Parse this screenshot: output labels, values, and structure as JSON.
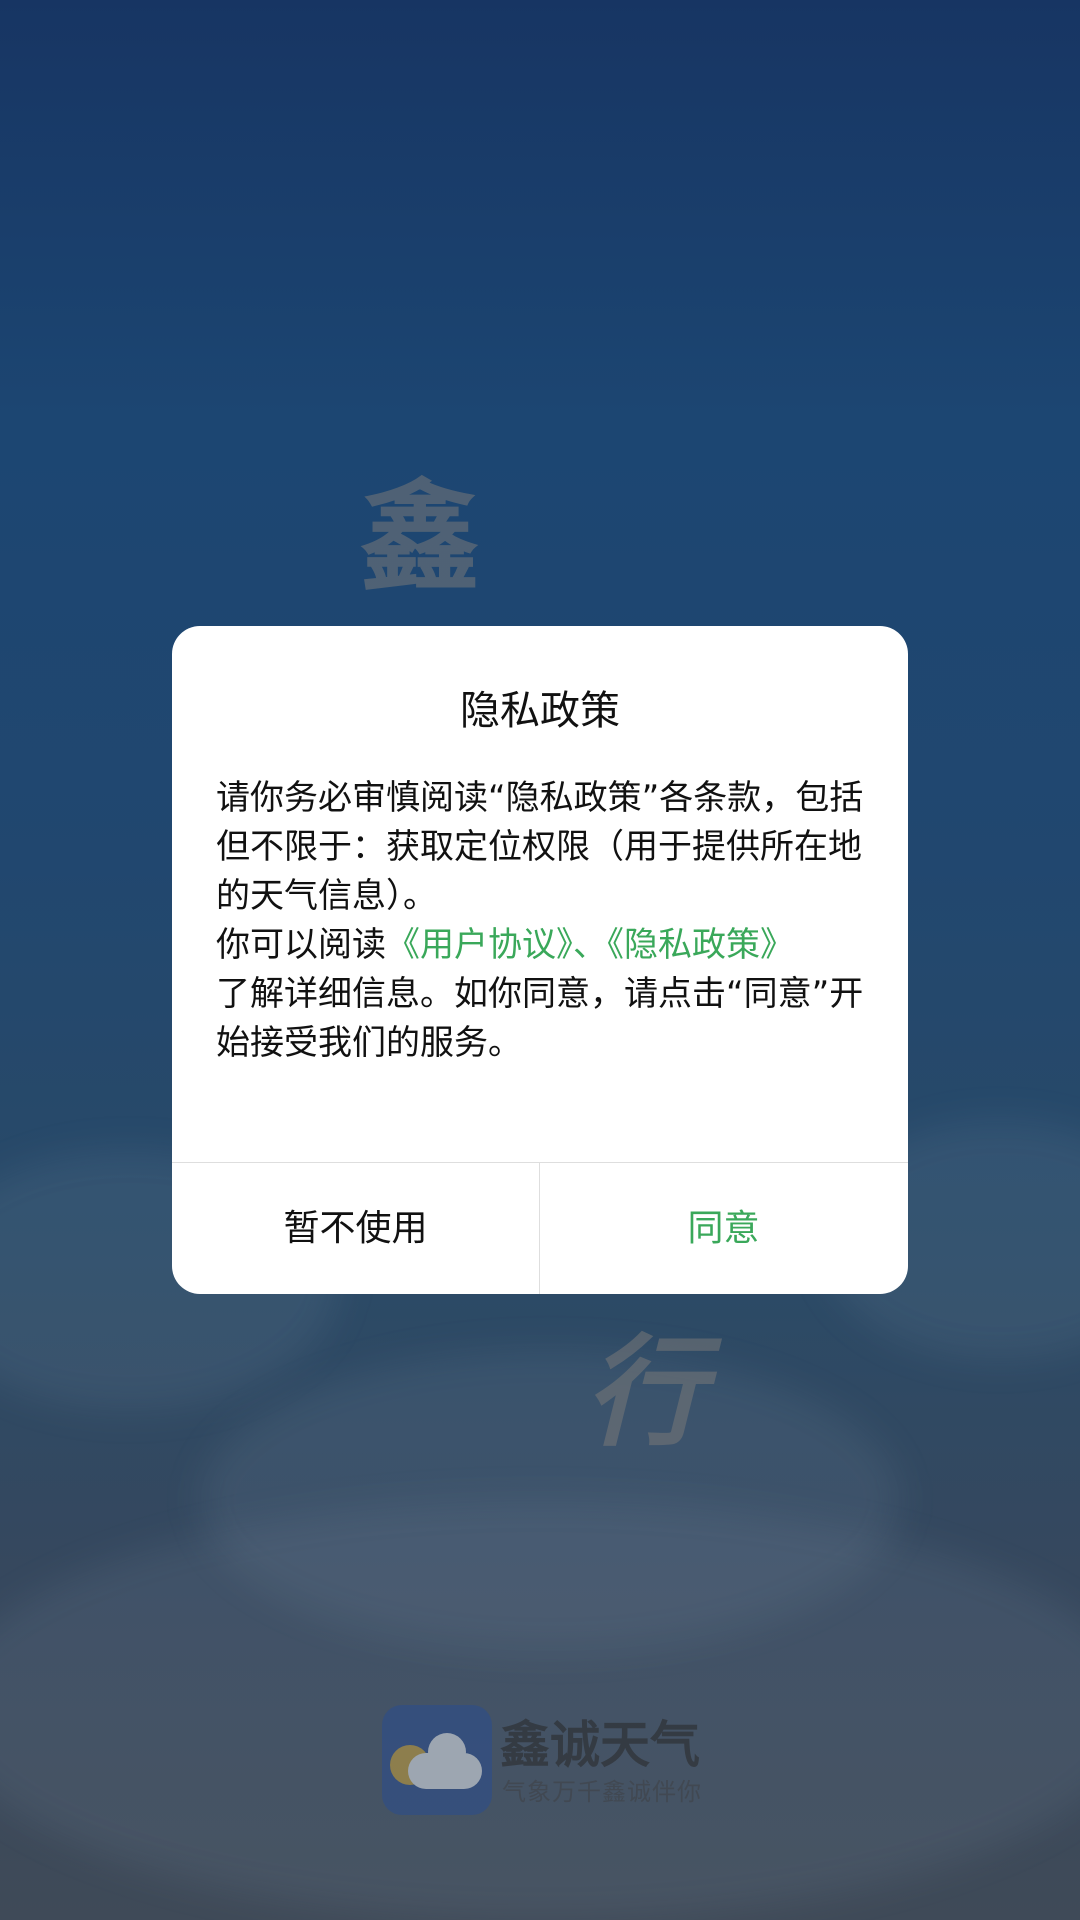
{
  "background": {
    "char_top": "鑫",
    "char_mid": "行"
  },
  "splash": {
    "app_name": "鑫诚天气",
    "slogan": "气象万千鑫诚伴你",
    "logo_icon": "weather-app-logo-icon"
  },
  "dialog": {
    "title": "隐私政策",
    "paragraph1": "请你务必审慎阅读“隐私政策”各条款，包括但不限于：获取定位权限（用于提供所在地的天气信息）。",
    "read_prefix": "你可以阅读",
    "user_agreement_link": "《用户协议》",
    "separator": "、",
    "privacy_policy_link": "《隐私政策》",
    "paragraph3": "了解详细信息。如你同意，请点击“同意”开始接受我们的服务。",
    "decline_label": "暂不使用",
    "agree_label": "同意"
  },
  "colors": {
    "accent_green": "#3aa85a",
    "dialog_bg": "#ffffff",
    "background_top": "#173563",
    "background_bottom": "#3f4a58"
  }
}
